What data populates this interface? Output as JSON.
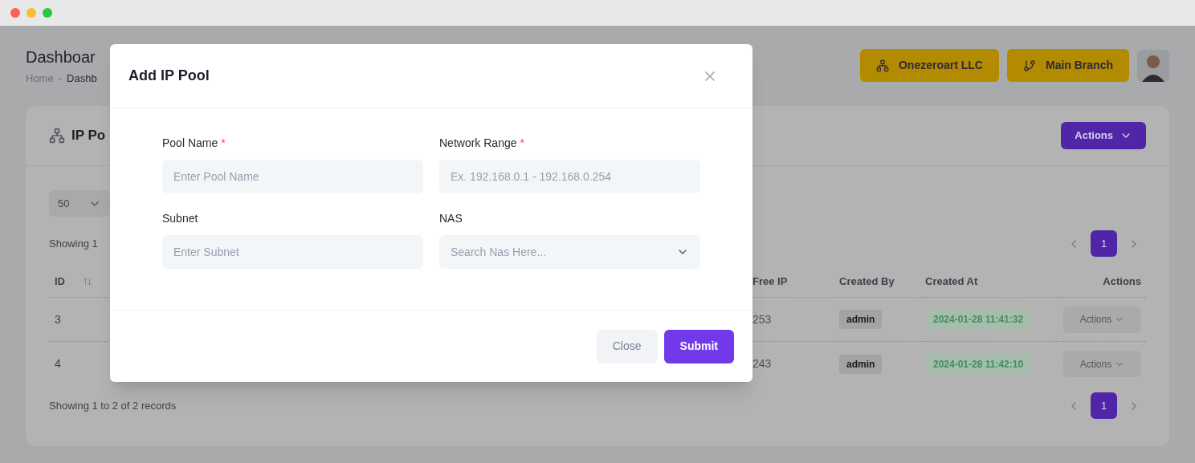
{
  "page": {
    "title": "Dashboar",
    "breadcrumb": [
      {
        "label": "Home",
        "kind": "link"
      },
      {
        "label": "-",
        "kind": "separator"
      },
      {
        "label": "Dashb",
        "kind": "current"
      }
    ]
  },
  "header_buttons": [
    {
      "label": "Onezeroart LLC",
      "kind": "company"
    },
    {
      "label": "Main Branch",
      "kind": "branch"
    }
  ],
  "card": {
    "title": "IP Po",
    "actions": "Actions",
    "page_size": "50",
    "summary_top": "Showing 1",
    "summary_bottom": "Showing 1 to 2 of 2 records",
    "pages_top": [
      {
        "label": "1",
        "selected": true
      }
    ],
    "pages_bottom": [
      {
        "label": "1",
        "selected": true
      }
    ]
  },
  "table": {
    "columns": [
      "ID",
      "Free IP",
      "Created By",
      "Created At",
      "Actions"
    ],
    "rows": [
      {
        "id": "3",
        "free_ip": "253",
        "created_by": "admin",
        "created_at": "2024-01-28 11:41:32",
        "action": "Actions"
      },
      {
        "id": "4",
        "free_ip": "243",
        "created_by": "admin",
        "created_at": "2024-01-28 11:42:10",
        "action": "Actions"
      }
    ]
  },
  "modal": {
    "title": "Add IP Pool",
    "fields": [
      {
        "label": "Pool Name",
        "required_mark": "*",
        "placeholder": "Enter Pool Name",
        "kind": "text"
      },
      {
        "label": "Network Range",
        "required_mark": "*",
        "placeholder": "Ex. 192.168.0.1 - 192.168.0.254",
        "kind": "text"
      },
      {
        "label": "Subnet",
        "placeholder": "Enter Subnet",
        "kind": "text"
      },
      {
        "label": "NAS",
        "placeholder": "Search Nas Here...",
        "kind": "select"
      }
    ],
    "buttons": [
      {
        "label": "Close",
        "kind": "secondary"
      },
      {
        "label": "Submit",
        "kind": "primary"
      }
    ]
  }
}
